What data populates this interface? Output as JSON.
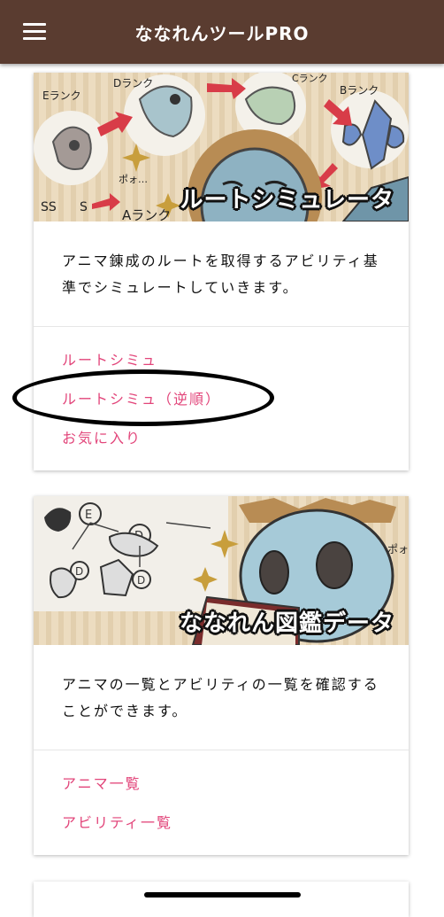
{
  "header": {
    "title": "ななれんツールPRO"
  },
  "cards": [
    {
      "banner_title": "ルートシミュレータ",
      "description": "アニマ錬成のルートを取得するアビリティ基準でシミュレートしていきます。",
      "links": [
        "ルートシミュ",
        "ルートシミュ（逆順）",
        "お気に入り"
      ],
      "banner_labels": [
        "Eランク",
        "Dランク",
        "Cランク",
        "Bランク",
        "SS",
        "S",
        "Aランク",
        "ポォ…"
      ]
    },
    {
      "banner_title": "ななれん図鑑データ",
      "description": "アニマの一覧とアビリティの一覧を確認することができます。",
      "links": [
        "アニマ一覧",
        "アビリティ一覧"
      ],
      "banner_labels": [
        "E",
        "D",
        "D",
        "D",
        "ポォ"
      ]
    }
  ],
  "colors": {
    "appbar": "#5a3c30",
    "link": "#e2457a",
    "banner_bg": "#ecdcc0"
  }
}
